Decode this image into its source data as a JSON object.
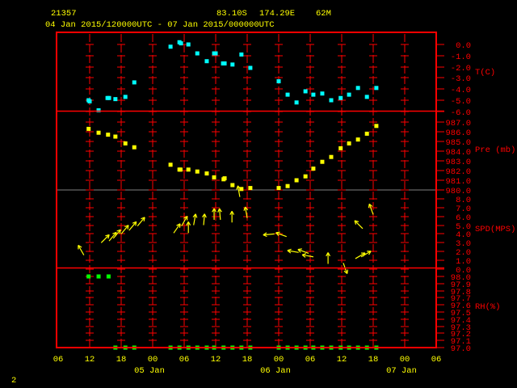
{
  "header": {
    "station_id": "21357",
    "latitude": "83.10S",
    "longitude": "174.29E",
    "elevation": "62M",
    "time_range": "04 Jan 2015/120000UTC - 07 Jan 2015/000000UTC"
  },
  "page_number": "2",
  "colors": {
    "frame": "#ff0000",
    "text": "#ffff00",
    "temperature": "#00ffff",
    "pressure": "#ffff00",
    "wind": "#ffff00",
    "rh": "#00ff00",
    "grid": "#ff0000",
    "midline": "#808080"
  },
  "chart_data": {
    "type": "scatter",
    "title": "21357 83.10S 174.29E 62M",
    "subtitle": "04 Jan 2015/120000UTC - 07 Jan 2015/000000UTC",
    "x_units": "hours since 04 Jan 2015 06UTC",
    "xlim": [
      0,
      72
    ],
    "x_ticks": [
      {
        "h": 0,
        "label": "06"
      },
      {
        "h": 6,
        "label": "12"
      },
      {
        "h": 12,
        "label": "18"
      },
      {
        "h": 18,
        "label": "00"
      },
      {
        "h": 24,
        "label": "06"
      },
      {
        "h": 30,
        "label": "12"
      },
      {
        "h": 36,
        "label": "18"
      },
      {
        "h": 42,
        "label": "00"
      },
      {
        "h": 48,
        "label": "06"
      },
      {
        "h": 54,
        "label": "12"
      },
      {
        "h": 60,
        "label": "18"
      },
      {
        "h": 66,
        "label": "00"
      },
      {
        "h": 72,
        "label": "06"
      }
    ],
    "day_labels": [
      {
        "h": 18,
        "label": "05 Jan"
      },
      {
        "h": 42,
        "label": "06 Jan"
      },
      {
        "h": 66,
        "label": "07 Jan"
      }
    ],
    "panels": [
      {
        "name": "temperature",
        "label": "T(C)",
        "ylim": [
          -6,
          0
        ],
        "tick_labels": [
          "0.0",
          "-1.0",
          "-2.0",
          "-3.0",
          "-4.0",
          "-5.0",
          "-6.0"
        ],
        "tick_values": [
          0,
          -1,
          -2,
          -3,
          -4,
          -5,
          -6
        ],
        "points": [
          [
            5.8,
            -5.0
          ],
          [
            6.0,
            -5.1
          ],
          [
            7.7,
            -5.9
          ],
          [
            9.4,
            -4.8
          ],
          [
            9.7,
            -4.8
          ],
          [
            10.9,
            -4.9
          ],
          [
            12.8,
            -4.7
          ],
          [
            14.5,
            -3.4
          ],
          [
            21.4,
            -0.2
          ],
          [
            23.1,
            0.2
          ],
          [
            23.4,
            0.1
          ],
          [
            24.8,
            0.0
          ],
          [
            26.5,
            -0.8
          ],
          [
            28.3,
            -1.5
          ],
          [
            29.7,
            -0.8
          ],
          [
            30.0,
            -0.8
          ],
          [
            31.4,
            -1.7
          ],
          [
            31.7,
            -1.7
          ],
          [
            33.2,
            -1.8
          ],
          [
            34.9,
            -0.9
          ],
          [
            36.6,
            -2.1
          ],
          [
            42.0,
            -3.3
          ],
          [
            43.7,
            -4.5
          ],
          [
            45.4,
            -5.2
          ],
          [
            47.1,
            -4.2
          ],
          [
            48.6,
            -4.5
          ],
          [
            50.3,
            -4.4
          ],
          [
            52.0,
            -5.0
          ],
          [
            53.8,
            -4.8
          ],
          [
            55.4,
            -4.5
          ],
          [
            57.1,
            -3.9
          ],
          [
            58.8,
            -4.7
          ],
          [
            60.6,
            -3.9
          ]
        ]
      },
      {
        "name": "pressure",
        "label": "Pre (mb)",
        "ylim": [
          980,
          987
        ],
        "tick_labels": [
          "987.0",
          "986.0",
          "985.0",
          "984.0",
          "983.0",
          "982.0",
          "981.0",
          "980.0"
        ],
        "tick_values": [
          987,
          986,
          985,
          984,
          983,
          982,
          981,
          980
        ],
        "points": [
          [
            5.8,
            986.3
          ],
          [
            7.7,
            985.9
          ],
          [
            9.5,
            985.7
          ],
          [
            10.9,
            985.5
          ],
          [
            12.8,
            984.8
          ],
          [
            14.5,
            984.4
          ],
          [
            21.4,
            982.6
          ],
          [
            23.1,
            982.1
          ],
          [
            23.3,
            982.1
          ],
          [
            24.8,
            982.1
          ],
          [
            26.5,
            981.9
          ],
          [
            28.3,
            981.7
          ],
          [
            29.7,
            981.3
          ],
          [
            31.5,
            981.1
          ],
          [
            31.7,
            981.2
          ],
          [
            33.2,
            980.5
          ],
          [
            34.9,
            980.1
          ],
          [
            36.6,
            980.2
          ],
          [
            42.0,
            980.2
          ],
          [
            43.7,
            980.4
          ],
          [
            45.4,
            981.0
          ],
          [
            47.1,
            981.4
          ],
          [
            48.6,
            982.2
          ],
          [
            50.3,
            982.9
          ],
          [
            52.0,
            983.4
          ],
          [
            53.8,
            984.3
          ],
          [
            55.4,
            984.8
          ],
          [
            57.1,
            985.2
          ],
          [
            58.8,
            985.8
          ],
          [
            60.6,
            986.6
          ]
        ]
      },
      {
        "name": "wind",
        "label": "SPD(MPS)",
        "ylim": [
          0,
          8
        ],
        "tick_labels": [
          "8.0",
          "7.0",
          "6.0",
          "5.0",
          "4.0",
          "3.0",
          "2.0",
          "1.0",
          "0.0"
        ],
        "tick_values": [
          8,
          7,
          6,
          5,
          4,
          3,
          2,
          1,
          0
        ],
        "points_format": "[hour, speed_mps, arrow_direction_deg_clockwise_from_up]",
        "points": [
          [
            4.9,
            1.6,
            -30
          ],
          [
            8.2,
            3.0,
            45
          ],
          [
            9.7,
            3.2,
            40
          ],
          [
            10.5,
            3.5,
            40
          ],
          [
            12.0,
            4.0,
            40
          ],
          [
            13.5,
            4.4,
            40
          ],
          [
            15.1,
            4.9,
            40
          ],
          [
            22.0,
            4.1,
            35
          ],
          [
            23.5,
            4.9,
            30
          ],
          [
            24.8,
            4.1,
            0
          ],
          [
            25.8,
            5.0,
            10
          ],
          [
            27.7,
            5.0,
            5
          ],
          [
            29.7,
            5.6,
            0
          ],
          [
            30.9,
            5.6,
            -5
          ],
          [
            33.1,
            5.3,
            0
          ],
          [
            34.6,
            8.2,
            -10
          ],
          [
            36.0,
            5.8,
            -10
          ],
          [
            41.2,
            4.0,
            -95
          ],
          [
            43.5,
            3.7,
            -70
          ],
          [
            45.8,
            1.9,
            -80
          ],
          [
            47.7,
            1.8,
            -70
          ],
          [
            48.6,
            1.4,
            -80
          ],
          [
            51.4,
            0.6,
            0
          ],
          [
            54.3,
            0.7,
            160
          ],
          [
            56.6,
            1.2,
            60
          ],
          [
            57.7,
            1.4,
            60
          ],
          [
            58.0,
            4.6,
            -45
          ],
          [
            60.0,
            6.2,
            -20
          ]
        ]
      },
      {
        "name": "relative_humidity",
        "label": "RH(%)",
        "ylim": [
          97.0,
          98.0
        ],
        "tick_labels": [
          "98.0",
          "97.9",
          "97.8",
          "97.7",
          "97.6",
          "97.5",
          "97.4",
          "97.3",
          "97.2",
          "97.1",
          "97.0"
        ],
        "tick_values": [
          98.0,
          97.9,
          97.8,
          97.7,
          97.6,
          97.5,
          97.4,
          97.3,
          97.2,
          97.1,
          97.0
        ],
        "points": [
          [
            5.8,
            98.0
          ],
          [
            7.7,
            98.0
          ],
          [
            9.6,
            98.0
          ],
          [
            10.9,
            97.0
          ],
          [
            12.8,
            97.0
          ],
          [
            14.5,
            97.0
          ],
          [
            21.4,
            97.0
          ],
          [
            23.1,
            97.0
          ],
          [
            24.8,
            97.0
          ],
          [
            26.5,
            97.0
          ],
          [
            28.3,
            97.0
          ],
          [
            29.7,
            97.0
          ],
          [
            31.5,
            97.0
          ],
          [
            33.2,
            97.0
          ],
          [
            34.9,
            97.0
          ],
          [
            36.6,
            97.0
          ],
          [
            42.0,
            97.0
          ],
          [
            43.7,
            97.0
          ],
          [
            45.4,
            97.0
          ],
          [
            47.1,
            97.0
          ],
          [
            48.6,
            97.0
          ],
          [
            50.3,
            97.0
          ],
          [
            52.0,
            97.0
          ],
          [
            53.8,
            97.0
          ],
          [
            55.4,
            97.0
          ],
          [
            57.1,
            97.0
          ],
          [
            58.8,
            97.0
          ],
          [
            60.6,
            97.0
          ]
        ]
      }
    ]
  }
}
